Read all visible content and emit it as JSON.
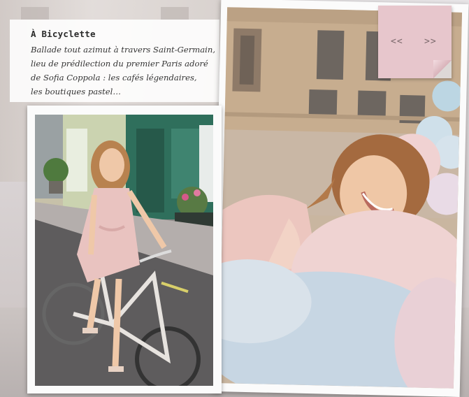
{
  "caption": {
    "title": "À Bicyclette",
    "lines": [
      "Ballade tout azimut à travers Saint-Germain,",
      "lieu de prédilection du premier Paris adoré",
      "de Sofia Coppola : les cafés légendaires,",
      "les boutiques pastel…"
    ]
  },
  "pager": {
    "prev_label": "<<",
    "next_label": ">>"
  },
  "colors": {
    "note": "#e7c6cc",
    "dress": "#e9c3c0",
    "storefront": "#2f6f5c",
    "balloon_pink": "#efd2d2",
    "balloon_blue": "#c7d6e3"
  },
  "icons": {
    "prev": "double-chevron-left-icon",
    "next": "double-chevron-right-icon"
  }
}
